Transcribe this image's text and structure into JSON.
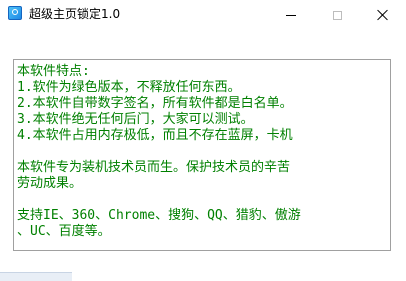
{
  "window": {
    "title": "超级主页锁定1.0",
    "icon": "app-lock-icon"
  },
  "controls": {
    "minimize_icon": "minimize-icon",
    "maximize_icon": "maximize-icon",
    "close_icon": "close-icon"
  },
  "content": {
    "text_color": "#008000",
    "lines": [
      "本软件特点:",
      "1.软件为绿色版本，不释放任何东西。",
      "2.本软件自带数字签名，所有软件都是白名单。",
      "3.本软件绝无任何后门，大家可以测试。",
      "4.本软件占用内存极低，而且不存在蓝屏，卡机",
      "",
      "本软件专为装机技术员而生。保护技术员的辛苦",
      "劳动成果。",
      "",
      "支持IE、360、Chrome、搜狗、QQ、猎豹、傲游",
      "、UC、百度等。"
    ]
  }
}
